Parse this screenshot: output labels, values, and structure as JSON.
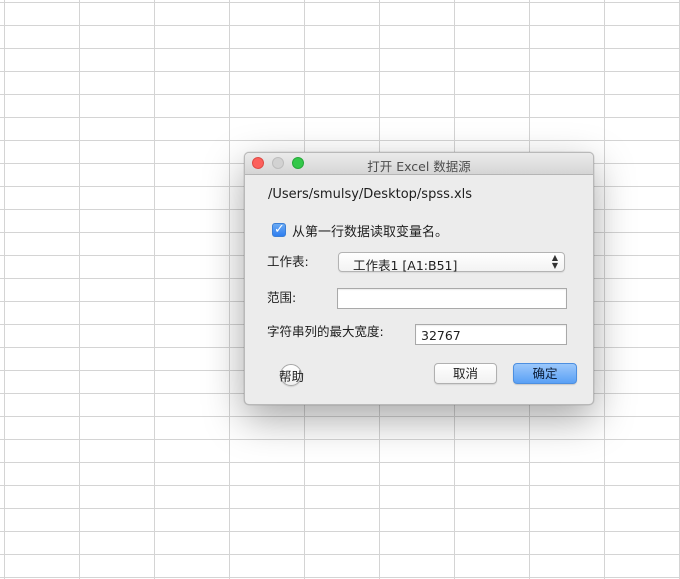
{
  "dialog": {
    "title": "打开 Excel 数据源",
    "file_path": "/Users/smulsy/Desktop/spss.xls",
    "read_var_names": {
      "checked": true,
      "label": "从第一行数据读取变量名。"
    },
    "worksheet": {
      "label": "工作表:",
      "selected": "工作表1 [A1:B51]"
    },
    "range": {
      "label": "范围:",
      "value": ""
    },
    "max_string_width": {
      "label": "字符串列的最大宽度:",
      "value": "32767"
    },
    "buttons": {
      "help": "帮助",
      "cancel": "取消",
      "ok": "确定"
    }
  }
}
